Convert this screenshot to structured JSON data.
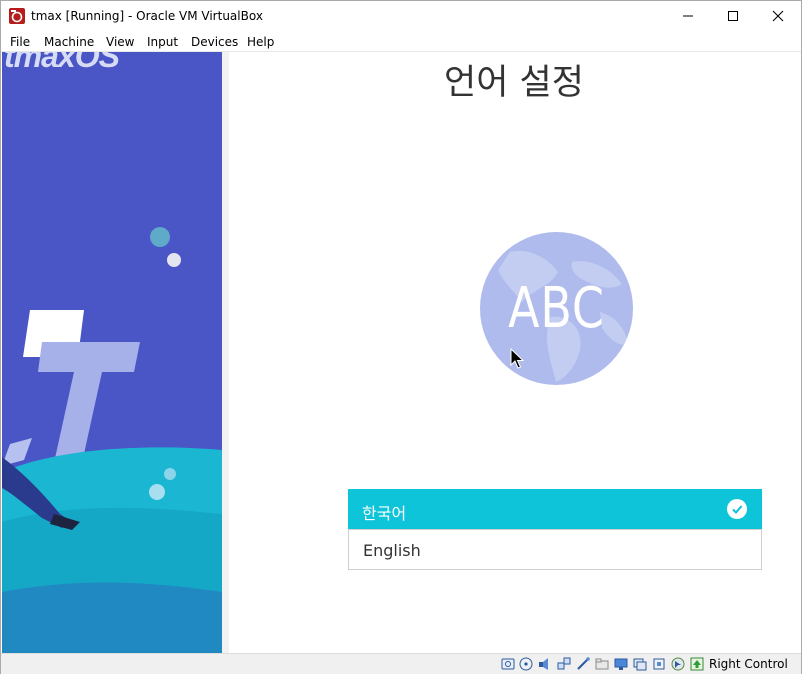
{
  "window": {
    "title": "tmax [Running] - Oracle VM VirtualBox",
    "controls": [
      "minimize",
      "maximize",
      "close"
    ]
  },
  "menu": {
    "items": [
      {
        "label": "File"
      },
      {
        "label": "Machine"
      },
      {
        "label": "View"
      },
      {
        "label": "Input"
      },
      {
        "label": "Devices"
      },
      {
        "label": "Help"
      }
    ]
  },
  "guest": {
    "brand": "tmaxOS",
    "heading": "언어 설정",
    "globe_text": "ABC",
    "languages": [
      {
        "label": "한국어",
        "selected": true
      },
      {
        "label": "English",
        "selected": false
      }
    ],
    "colors": {
      "panel": "#4a56c6",
      "accent": "#0ec4d8",
      "globe": "#aebbec"
    }
  },
  "statusbar": {
    "icons": [
      "hard-disk-icon",
      "optical-drive-icon",
      "audio-icon",
      "network-icon",
      "usb-icon",
      "shared-folders-icon",
      "display-icon",
      "video-capture-icon",
      "cpu-icon",
      "mouse-integration-icon",
      "keyboard-icon"
    ],
    "host_key": "Right Control"
  }
}
